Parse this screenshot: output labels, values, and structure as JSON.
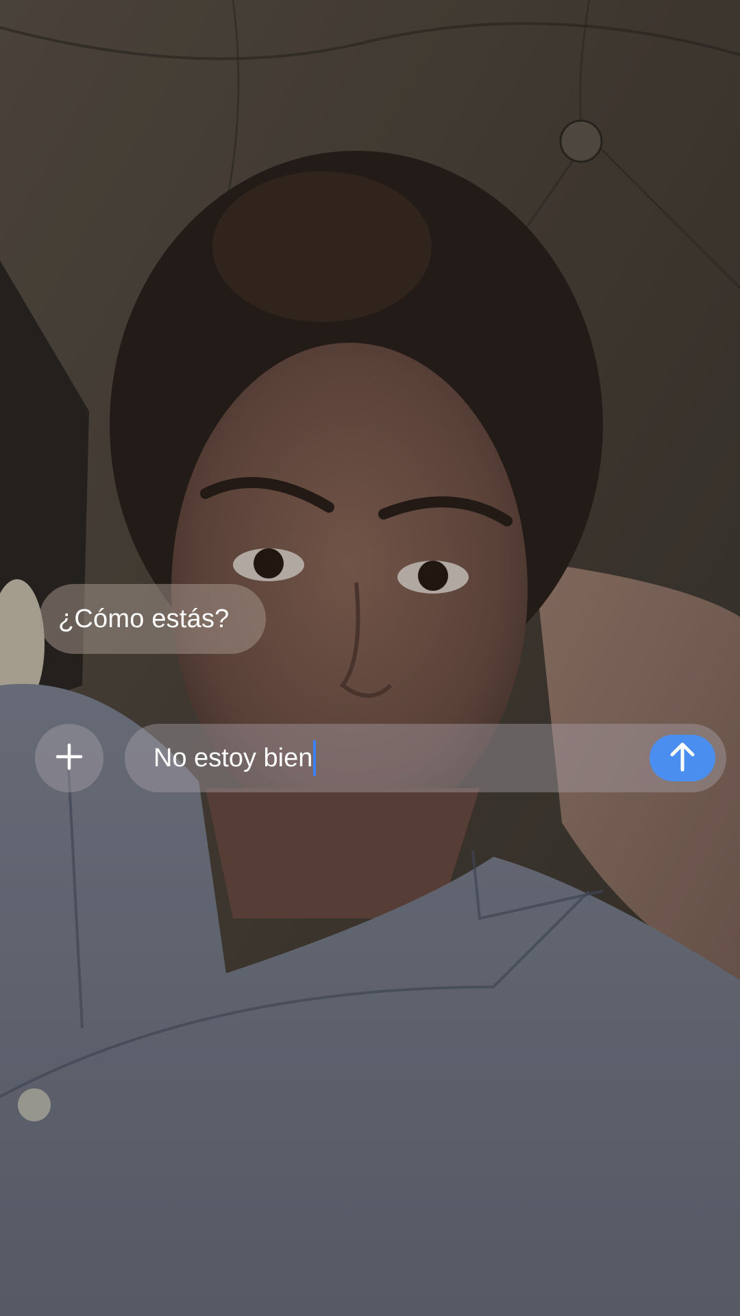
{
  "conversation": {
    "received_message": "¿Cómo estás?"
  },
  "composer": {
    "input_value": "No estoy bien",
    "plus_icon": "plus-icon",
    "send_icon": "arrow-up-icon",
    "send_color": "#4a8ff0",
    "cursor_color": "#3b82f6"
  }
}
